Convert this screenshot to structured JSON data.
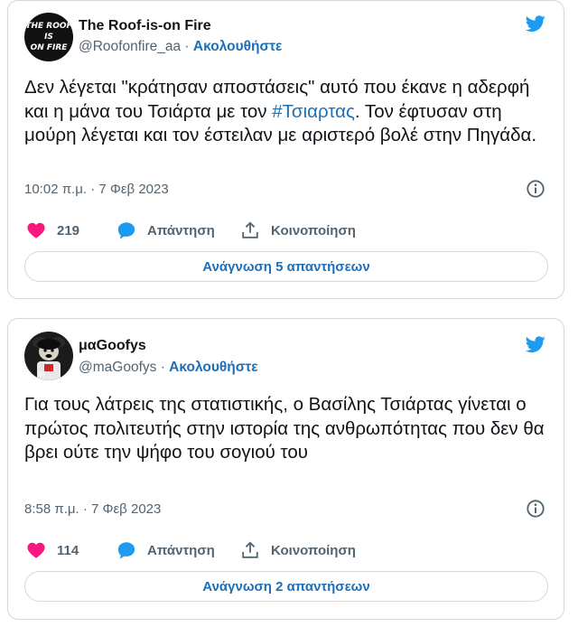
{
  "tweets": [
    {
      "author_name": "The Roof-is-on Fire",
      "handle": "@Roofonfire_aa",
      "separator": "·",
      "follow_label": "Ακολουθήστε",
      "avatar_text": "THE ROOF IS ON FIRE",
      "text_before": "Δεν λέγεται \"κράτησαν αποστάσεις\" αυτό που έκανε η αδερφή και η μάνα του Τσιάρτα με τον ",
      "hashtag": "#Τσιαρτας",
      "text_after": ". Τον έφτυσαν στη μούρη λέγεται και τον έστειλαν με αριστερό βολέ στην Πηγάδα.",
      "timestamp": "10:02 π.μ. · 7 Φεβ 2023",
      "likes": "219",
      "reply_label": "Απάντηση",
      "share_label": "Κοινοποίηση",
      "read_replies_label": "Ανάγνωση 5 απαντήσεων"
    },
    {
      "author_name": "μαGoofys",
      "handle": "@maGoofys",
      "separator": "·",
      "follow_label": "Ακολουθήστε",
      "text": "Για τους λάτρεις της στατιστικής, ο Βασίλης Τσιάρτας γίνεται ο πρώτος πολιτευτής στην ιστορία της ανθρωπότητας που δεν θα βρει ούτε την ψήφο του σογιού του",
      "timestamp": "8:58 π.μ. · 7 Φεβ 2023",
      "likes": "114",
      "reply_label": "Απάντηση",
      "share_label": "Κοινοποίηση",
      "read_replies_label": "Ανάγνωση 2 απαντήσεων"
    }
  ],
  "icons": {
    "brand": "twitter-bird-icon",
    "info": "info-icon",
    "like": "heart-icon",
    "reply": "speech-bubble-icon",
    "share": "share-upload-icon"
  },
  "colors": {
    "brand_blue": "#1d9bf0",
    "link_blue": "#1d6fb8",
    "heart_pink": "#f91880",
    "border": "#cfd9de",
    "muted": "#536471"
  }
}
